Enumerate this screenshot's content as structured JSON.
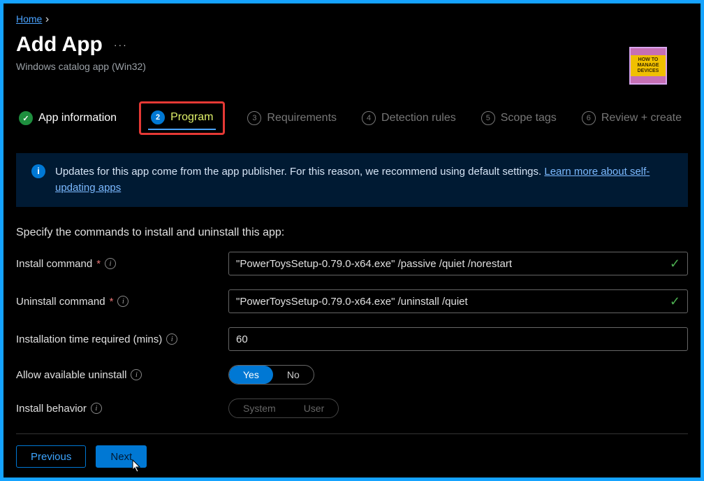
{
  "breadcrumb": {
    "home": "Home"
  },
  "header": {
    "title": "Add App",
    "subtitle": "Windows catalog app (Win32)",
    "logo_text": "HOW TO MANAGE DEVICES"
  },
  "steps": [
    {
      "num": "✓",
      "label": "App information",
      "state": "done"
    },
    {
      "num": "2",
      "label": "Program",
      "state": "active"
    },
    {
      "num": "3",
      "label": "Requirements",
      "state": "pending"
    },
    {
      "num": "4",
      "label": "Detection rules",
      "state": "pending"
    },
    {
      "num": "5",
      "label": "Scope tags",
      "state": "pending"
    },
    {
      "num": "6",
      "label": "Review + create",
      "state": "pending"
    }
  ],
  "banner": {
    "text": "Updates for this app come from the app publisher. For this reason, we recommend using default settings. ",
    "link": "Learn more about self-updating apps"
  },
  "section_intro": "Specify the commands to install and uninstall this app:",
  "fields": {
    "install_command": {
      "label": "Install command",
      "value": "\"PowerToysSetup-0.79.0-x64.exe\" /passive /quiet /norestart",
      "required": true
    },
    "uninstall_command": {
      "label": "Uninstall command",
      "value": "\"PowerToysSetup-0.79.0-x64.exe\" /uninstall /quiet",
      "required": true
    },
    "install_time": {
      "label": "Installation time required (mins)",
      "value": "60"
    },
    "allow_uninstall": {
      "label": "Allow available uninstall",
      "options": {
        "yes": "Yes",
        "no": "No"
      },
      "selected": "yes"
    },
    "install_behavior": {
      "label": "Install behavior",
      "options": {
        "system": "System",
        "user": "User"
      },
      "selected": "system",
      "disabled": true
    }
  },
  "footer": {
    "previous": "Previous",
    "next": "Next"
  },
  "colors": {
    "accent": "#0078d4",
    "frame": "#15a3ff",
    "highlight": "#e53935"
  }
}
